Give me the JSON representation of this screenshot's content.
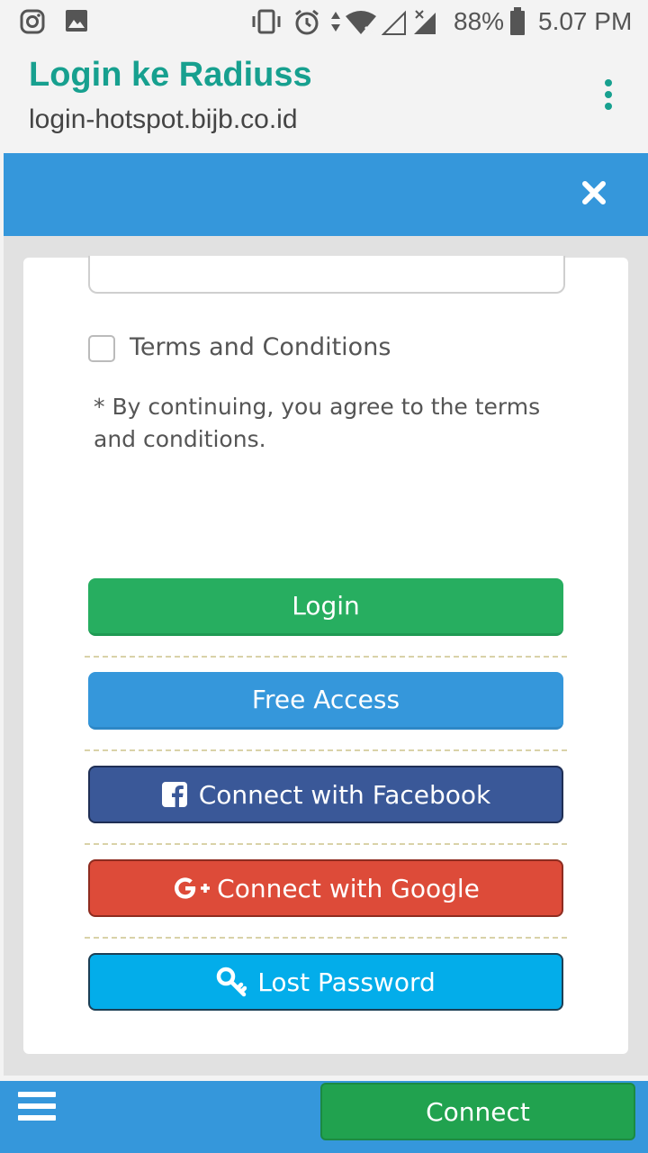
{
  "status_bar": {
    "battery_percent": "88%",
    "time": "5.07 PM",
    "icons": [
      "instagram-icon",
      "gallery-icon",
      "vibrate-icon",
      "alarm-icon",
      "data-arrows-icon",
      "wifi-icon",
      "signal-icon",
      "battery-icon"
    ]
  },
  "browser": {
    "title": "Login ke Radiuss",
    "url": "login-hotspot.bijb.co.id"
  },
  "modal": {
    "terms_label": "Terms and Conditions",
    "terms_checked": false,
    "terms_note": "* By continuing, you agree to the terms and conditions.",
    "buttons": {
      "login": "Login",
      "free_access": "Free Access",
      "facebook": "Connect with Facebook",
      "google": "Connect with Google",
      "lost_password": "Lost Password"
    }
  },
  "bottom_bar": {
    "connect_label": "Connect"
  },
  "colors": {
    "accent_teal": "#17a08f",
    "primary_blue": "#3597db",
    "login_green": "#27ae60",
    "facebook_blue": "#3a5898",
    "google_red": "#dd4b39",
    "lost_password_cyan": "#03adea",
    "connect_green": "#21a24f"
  }
}
